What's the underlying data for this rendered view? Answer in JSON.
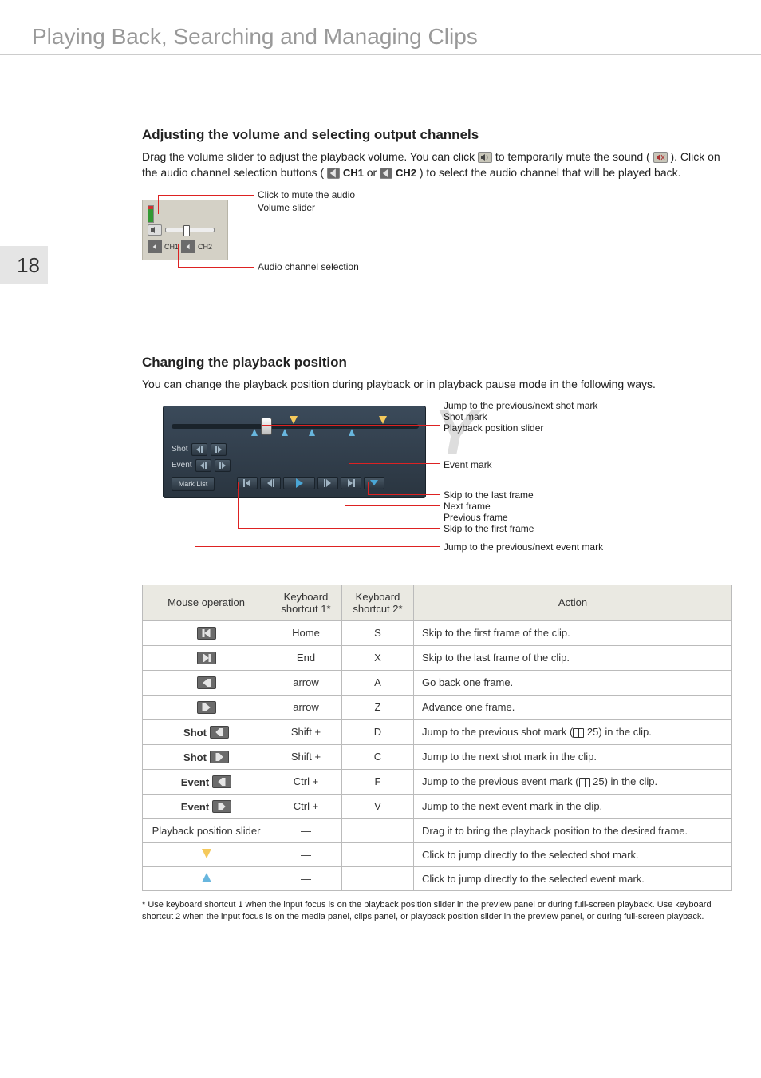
{
  "doc_title": "Playing Back, Searching and Managing Clips",
  "page_number": "18",
  "section1": {
    "title": "Adjusting the volume and selecting output channels",
    "p1a": "Drag the volume slider to adjust the playback volume. You can click ",
    "p1b": " to temporarily mute the sound (",
    "p1c": "). Click on the audio channel selection buttons (",
    "ch1": "CH1",
    "or": " or ",
    "ch2": "CH2",
    "p1d": ") to select the audio channel that will be played back.",
    "annot_mute": "Click to mute the audio",
    "annot_slider": "Volume slider",
    "annot_channel": "Audio channel selection",
    "fig_ch1": "CH1",
    "fig_ch2": "CH2"
  },
  "section2": {
    "title": "Changing the playback position",
    "p1": "You can change the playback position during playback or in playback pause mode in the following ways.",
    "fig": {
      "shot": "Shot",
      "event": "Event",
      "marklist": "Mark List",
      "a_shot_jump": "Jump to the previous/next shot mark",
      "a_shot_mark": "Shot mark",
      "a_pos_slider": "Playback position slider",
      "a_event_mark": "Event mark",
      "a_skip_last": "Skip to the last frame",
      "a_next_frame": "Next frame",
      "a_prev_frame": "Previous frame",
      "a_skip_first": "Skip to the first frame",
      "a_event_jump": "Jump to the previous/next event mark"
    }
  },
  "table": {
    "headers": {
      "mouse": "Mouse operation",
      "kb1": "Keyboard shortcut 1*",
      "kb2": "Keyboard shortcut 2*",
      "action": "Action"
    },
    "rows": [
      {
        "op_label": "",
        "icon": "skip-first",
        "kb1": "Home",
        "kb2": "S",
        "action_full": "Skip to the first frame of the clip."
      },
      {
        "op_label": "",
        "icon": "skip-last",
        "kb1": "End",
        "kb2": "X",
        "action_full": "Skip to the last frame of the clip."
      },
      {
        "op_label": "",
        "icon": "frame-back",
        "kb1": "arrow",
        "kb2": "A",
        "action_full": "Go back one frame."
      },
      {
        "op_label": "",
        "icon": "frame-fwd",
        "kb1": "arrow",
        "kb2": "Z",
        "action_full": "Advance one frame."
      },
      {
        "op_label": "Shot",
        "icon": "jump-prev",
        "kb1": "Shift +",
        "kb2": "D",
        "action_a": "Jump to the previous shot mark (",
        "action_b": " 25) in the clip."
      },
      {
        "op_label": "Shot",
        "icon": "jump-next",
        "kb1": "Shift +",
        "kb2": "C",
        "action_full": "Jump to the next shot mark in the clip."
      },
      {
        "op_label": "Event",
        "icon": "jump-prev",
        "kb1": "Ctrl +",
        "kb2": "F",
        "action_a": "Jump to the previous event mark (",
        "action_b": " 25) in the clip."
      },
      {
        "op_label": "Event",
        "icon": "jump-next",
        "kb1": "Ctrl +",
        "kb2": "V",
        "action_full": "Jump to the next event mark in the clip."
      },
      {
        "op_text": "Playback position slider",
        "kb1": "—",
        "kb2": "",
        "action_full": "Drag it to bring the playback position to the desired frame."
      },
      {
        "op_shape": "tri-down-y",
        "kb1": "—",
        "kb2": "",
        "action_full": "Click to jump directly to the selected shot mark."
      },
      {
        "op_shape": "tri-up-b",
        "kb1": "—",
        "kb2": "",
        "action_full": "Click to jump directly to the selected event mark."
      }
    ]
  },
  "footnote": "* Use keyboard shortcut 1 when the input focus is on the playback position slider in the preview panel or during full-screen playback. Use keyboard shortcut 2 when the input focus is on the media panel, clips panel, or playback position slider in the preview panel, or during full-screen playback.",
  "watermark": "COPY"
}
